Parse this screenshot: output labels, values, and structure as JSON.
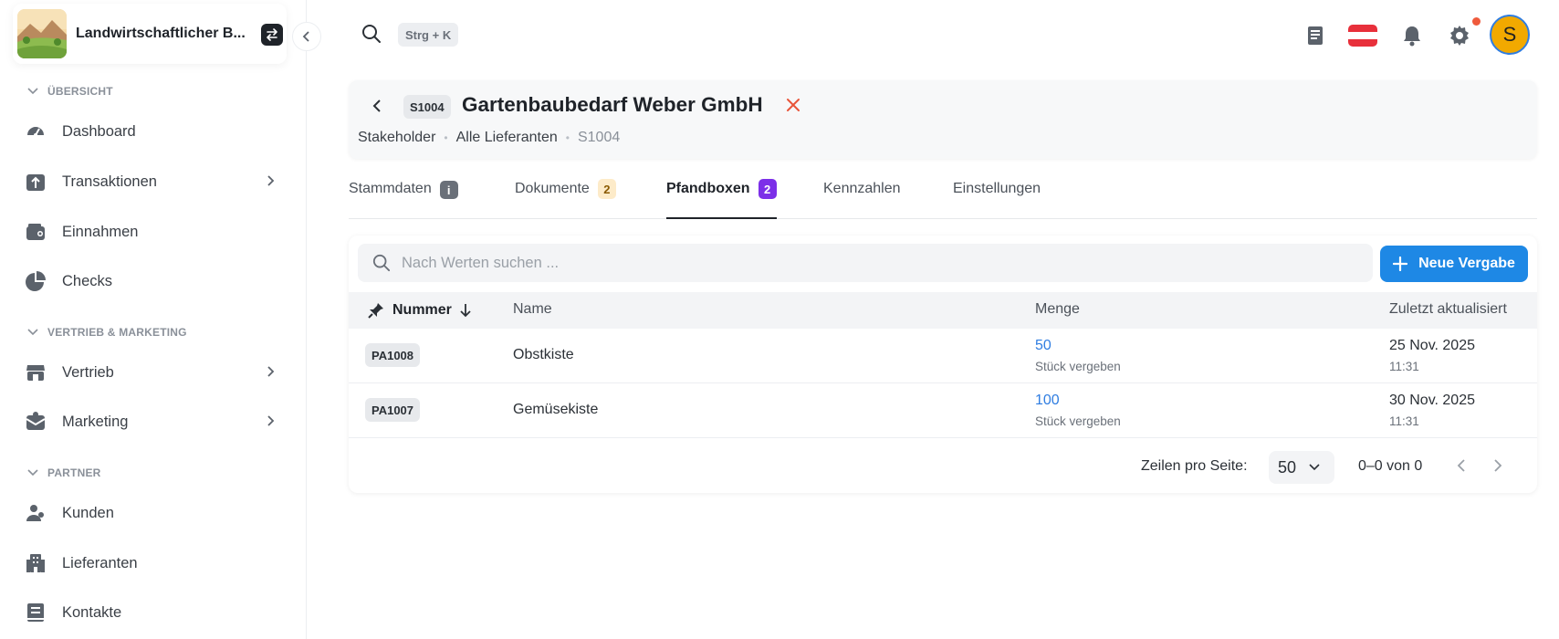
{
  "sidebar": {
    "org_name": "Landwirtschaftlicher B...",
    "sections": [
      {
        "label": "ÜBERSICHT"
      },
      {
        "label": "VERTRIEB & MARKETING"
      },
      {
        "label": "PARTNER"
      }
    ],
    "items": [
      {
        "label": "Dashboard",
        "icon": "gauge-icon"
      },
      {
        "label": "Transaktionen",
        "icon": "transfer-icon",
        "has_children": true
      },
      {
        "label": "Einnahmen",
        "icon": "wallet-icon"
      },
      {
        "label": "Checks",
        "icon": "pie-icon"
      },
      {
        "label": "Vertrieb",
        "icon": "store-icon",
        "has_children": true
      },
      {
        "label": "Marketing",
        "icon": "mail-icon",
        "has_children": true
      },
      {
        "label": "Kunden",
        "icon": "users-icon"
      },
      {
        "label": "Lieferanten",
        "icon": "building-icon"
      },
      {
        "label": "Kontakte",
        "icon": "contact-book-icon"
      }
    ]
  },
  "topbar": {
    "shortcut": "Strg + K",
    "avatar_initial": "S",
    "notification_dot_color": "#ef5a3c"
  },
  "header": {
    "id_tag": "S1004",
    "title": "Gartenbaubedarf Weber GmbH",
    "breadcrumb": [
      "Stakeholder",
      "Alle Lieferanten",
      "S1004"
    ]
  },
  "tabs": [
    {
      "label": "Stammdaten",
      "badge": "i"
    },
    {
      "label": "Dokumente",
      "badge": "2"
    },
    {
      "label": "Pfandboxen",
      "badge": "2",
      "active": true
    },
    {
      "label": "Kennzahlen"
    },
    {
      "label": "Einstellungen"
    }
  ],
  "table": {
    "search_placeholder": "Nach Werten suchen ...",
    "new_button": "Neue Vergabe",
    "columns": [
      "Nummer",
      "Name",
      "Menge",
      "Zuletzt aktualisiert"
    ],
    "rows": [
      {
        "nummer": "PA1008",
        "name": "Obstkiste",
        "menge": "50",
        "menge_sub": "Stück vergeben",
        "datum": "25 Nov. 2025",
        "zeit": "11:31"
      },
      {
        "nummer": "PA1007",
        "name": "Gemüsekiste",
        "menge": "100",
        "menge_sub": "Stück vergeben",
        "datum": "30 Nov. 2025",
        "zeit": "11:31"
      }
    ],
    "footer": {
      "rows_per_page_label": "Zeilen pro Seite:",
      "rows_per_page_value": "50",
      "range": "0–0 von 0"
    }
  },
  "colors": {
    "accent": "#1e88e5",
    "badge_violet": "#7c2fe8",
    "badge_amber": "#fdebc9",
    "close_red": "#e8553a"
  }
}
